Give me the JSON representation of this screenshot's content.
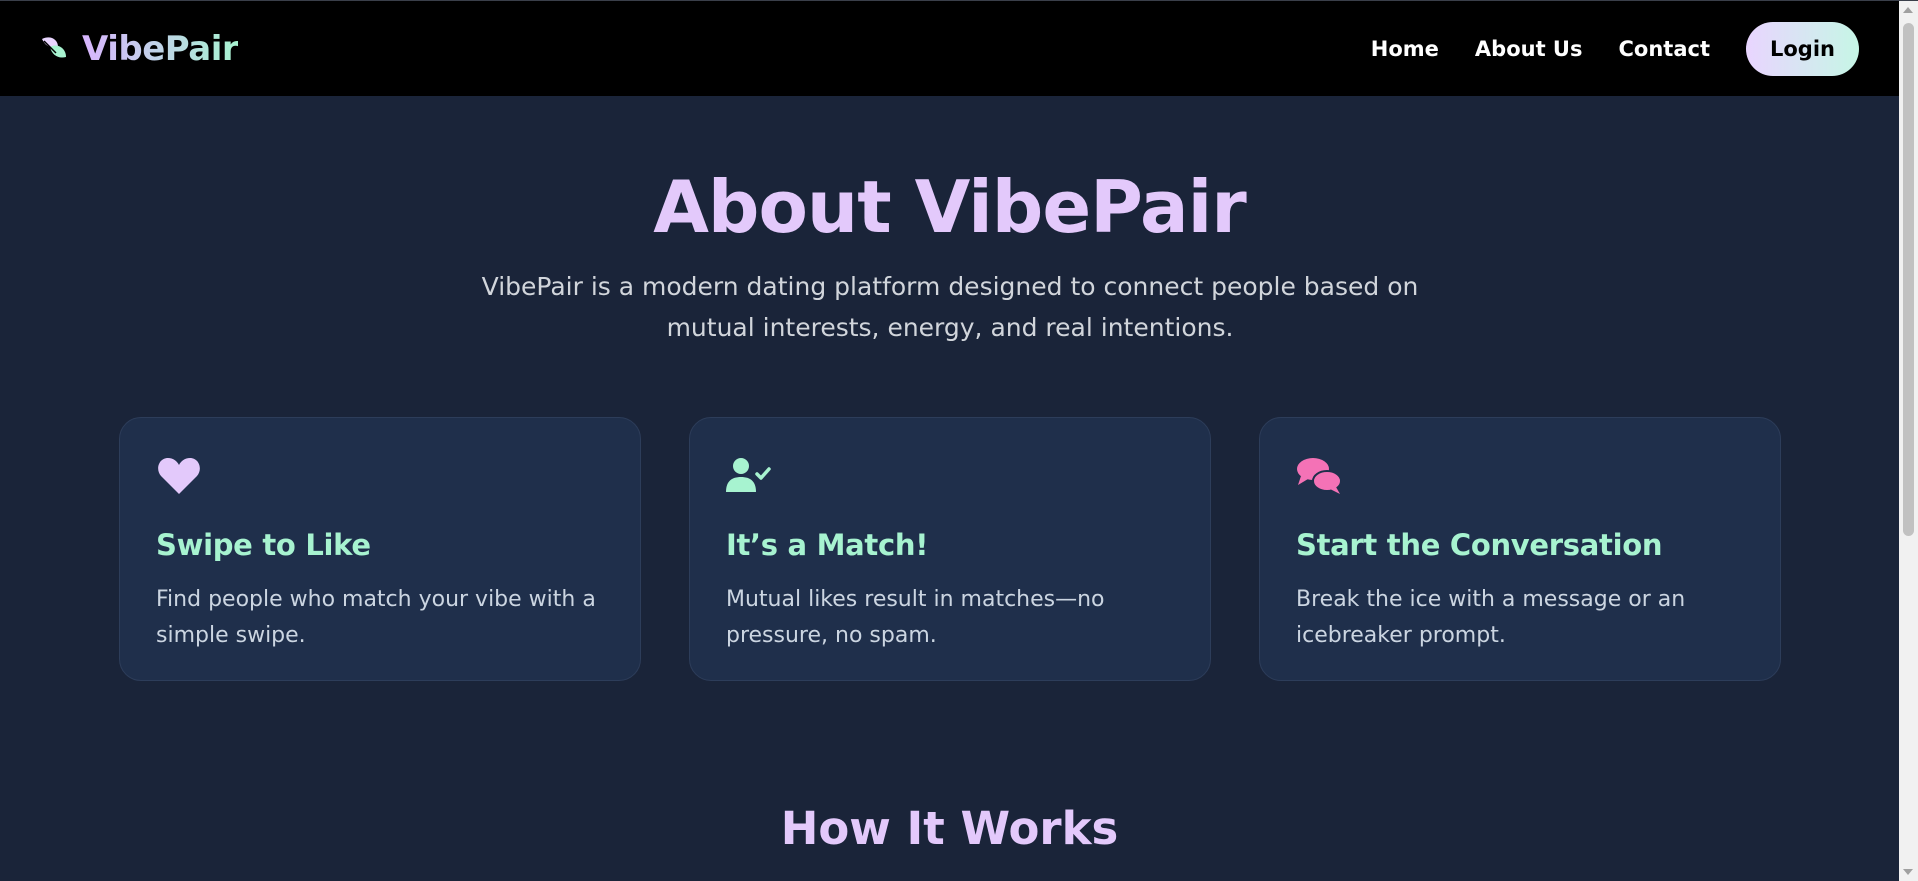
{
  "navbar": {
    "brand_name": "VibePair",
    "brand_icon": "leaf-heart-icon",
    "links": [
      "Home",
      "About Us",
      "Contact"
    ],
    "login_label": "Login"
  },
  "hero": {
    "title": "About VibePair",
    "subtitle": "VibePair is a modern dating platform designed to connect people based on mutual interests, energy, and real intentions."
  },
  "features": [
    {
      "icon": "heart-icon",
      "icon_color": "#e3c9fb",
      "title": "Swipe to Like",
      "text": "Find people who match your vibe with a simple swipe."
    },
    {
      "icon": "user-check-icon",
      "icon_color": "#a7f3d0",
      "title": "It’s a Match!",
      "text": "Mutual likes result in matches—no pressure, no spam."
    },
    {
      "icon": "chat-bubbles-icon",
      "icon_color": "#f472b6",
      "title": "Start the Conversation",
      "text": "Break the ice with a message or an icebreaker prompt."
    }
  ],
  "how_it_works": {
    "title": "How It Works"
  },
  "colors": {
    "background": "#1a2439",
    "navbar": "#000000",
    "accent_purple": "#e3c9fb",
    "accent_mint": "#a7f3d0",
    "accent_pink": "#f472b6",
    "card_bg": "#1f2f4b"
  }
}
